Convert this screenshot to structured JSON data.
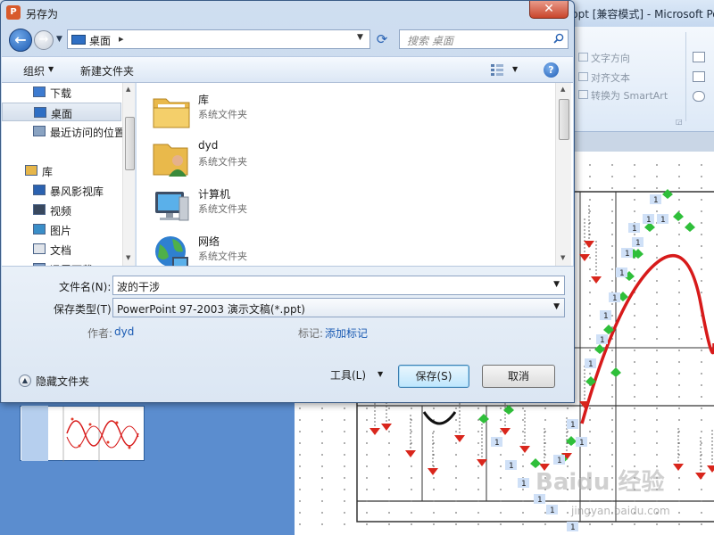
{
  "background_app": {
    "title_fragment": "ppt [兼容模式] - Microsoft Po",
    "ribbon": {
      "text_direction": "文字方向",
      "align_text": "对齐文本",
      "convert_smartart": "转换为 SmartArt"
    },
    "slide_labels": {
      "one": "1"
    },
    "watermark": {
      "brand": "Baidu 经验",
      "sub": "jingyan.baidu.com"
    }
  },
  "dialog": {
    "title": "另存为",
    "close_glyph": "✕",
    "address": {
      "location": "桌面",
      "separator": "▸"
    },
    "search_placeholder": "搜索 桌面",
    "toolbar": {
      "organize": "组织",
      "new_folder": "新建文件夹",
      "help": "?"
    },
    "nav": {
      "items": [
        {
          "label": "下载",
          "icon": "download-folder-icon",
          "selected": false
        },
        {
          "label": "桌面",
          "icon": "desktop-icon",
          "selected": true
        },
        {
          "label": "最近访问的位置",
          "icon": "recent-places-icon",
          "selected": false
        },
        {
          "label": "库",
          "icon": "libraries-icon",
          "selected": false
        },
        {
          "label": "暴风影视库",
          "icon": "video-library-icon",
          "selected": false
        },
        {
          "label": "视频",
          "icon": "video-icon",
          "selected": false
        },
        {
          "label": "图片",
          "icon": "pictures-icon",
          "selected": false
        },
        {
          "label": "文档",
          "icon": "documents-icon",
          "selected": false
        },
        {
          "label": "迅雷下载",
          "icon": "thunder-download-icon",
          "selected": false
        }
      ]
    },
    "files": [
      {
        "name": "库",
        "type": "系统文件夹",
        "icon": "libraries-folder-icon"
      },
      {
        "name": "dyd",
        "type": "系统文件夹",
        "icon": "user-folder-icon"
      },
      {
        "name": "计算机",
        "type": "系统文件夹",
        "icon": "computer-icon"
      },
      {
        "name": "网络",
        "type": "系统文件夹",
        "icon": "network-icon"
      }
    ],
    "form": {
      "filename_label": "文件名(N):",
      "filename_value": "波的干涉",
      "filetype_label": "保存类型(T):",
      "filetype_value": "PowerPoint 97-2003 演示文稿(*.ppt)",
      "author_label": "作者:",
      "author_value": "dyd",
      "tags_label": "标记:",
      "tags_value": "添加标记",
      "hide_folders": "隐藏文件夹",
      "tools": "工具(L)",
      "save": "保存(S)",
      "cancel": "取消"
    }
  },
  "colors": {
    "accent_blue": "#1b5bb3",
    "close_red": "#c9452c",
    "curve_red": "#d71a1a"
  }
}
